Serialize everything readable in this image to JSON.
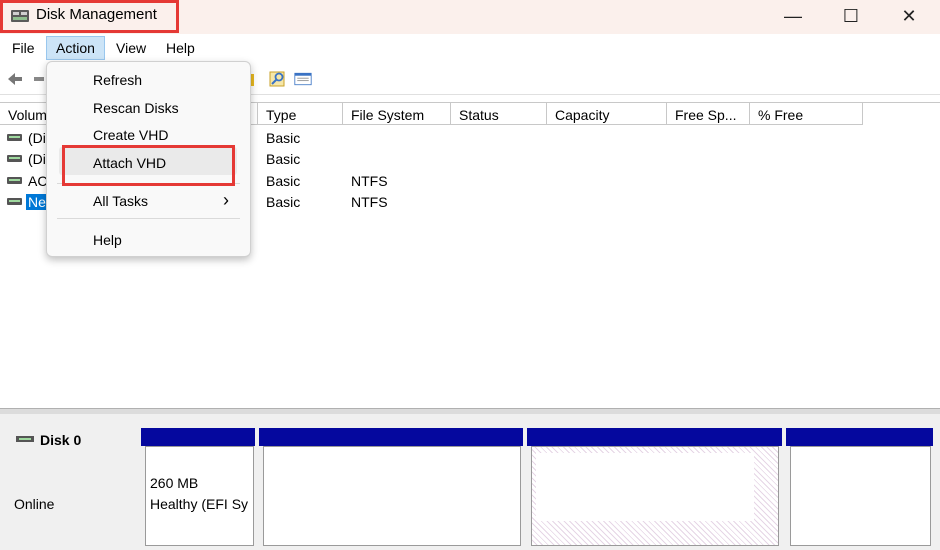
{
  "window": {
    "title": "Disk Management",
    "controls": {
      "minimize": "—",
      "maximize": "☐",
      "close": "✕"
    }
  },
  "menubar": {
    "items": [
      {
        "id": "file",
        "label": "File"
      },
      {
        "id": "action",
        "label": "Action"
      },
      {
        "id": "view",
        "label": "View"
      },
      {
        "id": "help",
        "label": "Help"
      }
    ]
  },
  "action_menu": {
    "items": {
      "refresh": "Refresh",
      "rescan": "Rescan Disks",
      "create_vhd": "Create VHD",
      "attach_vhd": "Attach VHD",
      "all_tasks": "All Tasks",
      "all_tasks_arrow": "›",
      "help": "Help"
    }
  },
  "volume_list": {
    "columns": {
      "volume": "Volum",
      "type": "Type",
      "file_system": "File System",
      "status": "Status",
      "capacity": "Capacity",
      "free_space": "Free Sp...",
      "percent_free": "% Free"
    },
    "rows": [
      {
        "volume": "(Di",
        "type": "Basic",
        "file_system": ""
      },
      {
        "volume": "(Di",
        "type": "Basic",
        "file_system": ""
      },
      {
        "volume": "AC",
        "type": "Basic",
        "file_system": "NTFS"
      },
      {
        "volume": "Ne",
        "type": "Basic",
        "file_system": "NTFS"
      }
    ]
  },
  "disk_map": {
    "disk_name": "Disk 0",
    "disk_status": "Online",
    "partition1": {
      "size": "260 MB",
      "status": "Healthy (EFI Sy"
    }
  },
  "colors": {
    "partition_bar": "#05089e",
    "highlight_border": "#e53935",
    "selection": "#0078d7"
  }
}
